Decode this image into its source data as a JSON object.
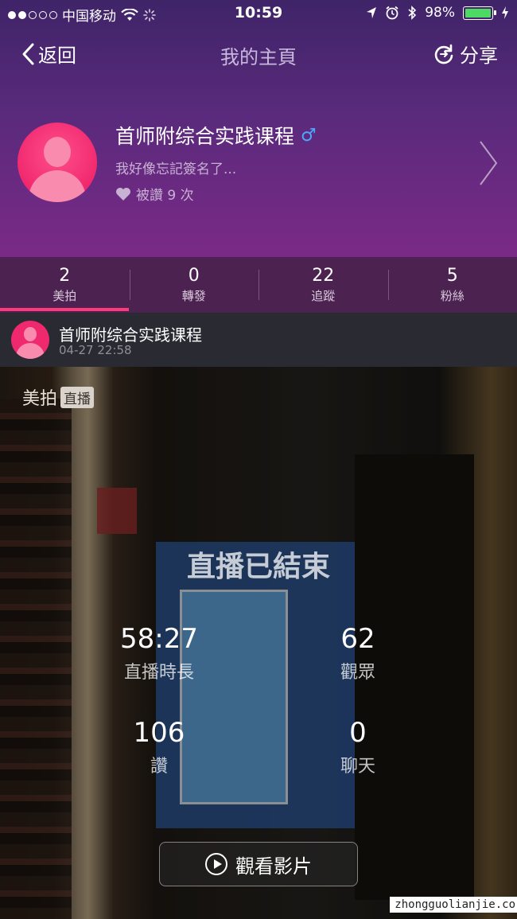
{
  "status_bar": {
    "carrier": "中国移动",
    "time": "10:59",
    "battery": "98%"
  },
  "nav": {
    "back_label": "返回",
    "title": "我的主頁",
    "share_label": "分享"
  },
  "profile": {
    "name": "首师附综合实践课程",
    "gender_symbol": "♂",
    "bio": "我好像忘記簽名了...",
    "likes_text": "被讚 9 次"
  },
  "stats": [
    {
      "num": "2",
      "label": "美拍"
    },
    {
      "num": "0",
      "label": "轉發"
    },
    {
      "num": "22",
      "label": "追蹤"
    },
    {
      "num": "5",
      "label": "粉絲"
    }
  ],
  "post": {
    "author": "首师附综合实践课程",
    "time": "04-27 22:58",
    "app_label": "美拍",
    "live_badge": "直播",
    "ended_title": "直播已結束",
    "metrics": [
      {
        "value": "58:27",
        "label": "直播時長"
      },
      {
        "value": "62",
        "label": "觀眾"
      },
      {
        "value": "106",
        "label": "讚"
      },
      {
        "value": "0",
        "label": "聊天"
      }
    ],
    "watch_label": "觀看影片"
  },
  "watermark": "zhongguolianjie.co",
  "colors": {
    "accent": "#ff3a7a",
    "avatar": "#f0286e",
    "gender": "#4aa8ff",
    "battery": "#4cd964"
  }
}
